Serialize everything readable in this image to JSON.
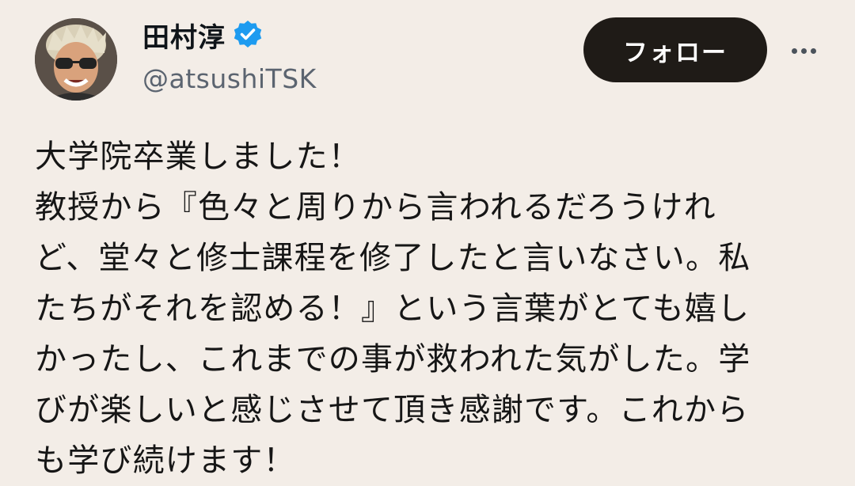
{
  "author": {
    "display_name": "田村淳",
    "handle": "@atsushiTSK",
    "verified": true,
    "avatar_icon": "profile-photo-avatar"
  },
  "actions": {
    "follow_label": "フォロー",
    "more_icon": "more-horizontal-icon"
  },
  "tweet": {
    "lines": [
      "大学院卒業しました！",
      "教授から『色々と周りから言われるだろうけれ",
      "ど、堂々と修士課程を修了したと言いなさい。私",
      "たちがそれを認める！』という言葉がとても嬉し",
      "かったし、これまでの事が救われた気がした。学",
      "びが楽しいと感じさせて頂き感謝です。これから",
      "も学び続けます！"
    ]
  },
  "colors": {
    "background": "#f3ede7",
    "follow_button": "#1f1b17",
    "verified_badge": "#1d9bf0",
    "handle_text": "#5b6470"
  }
}
